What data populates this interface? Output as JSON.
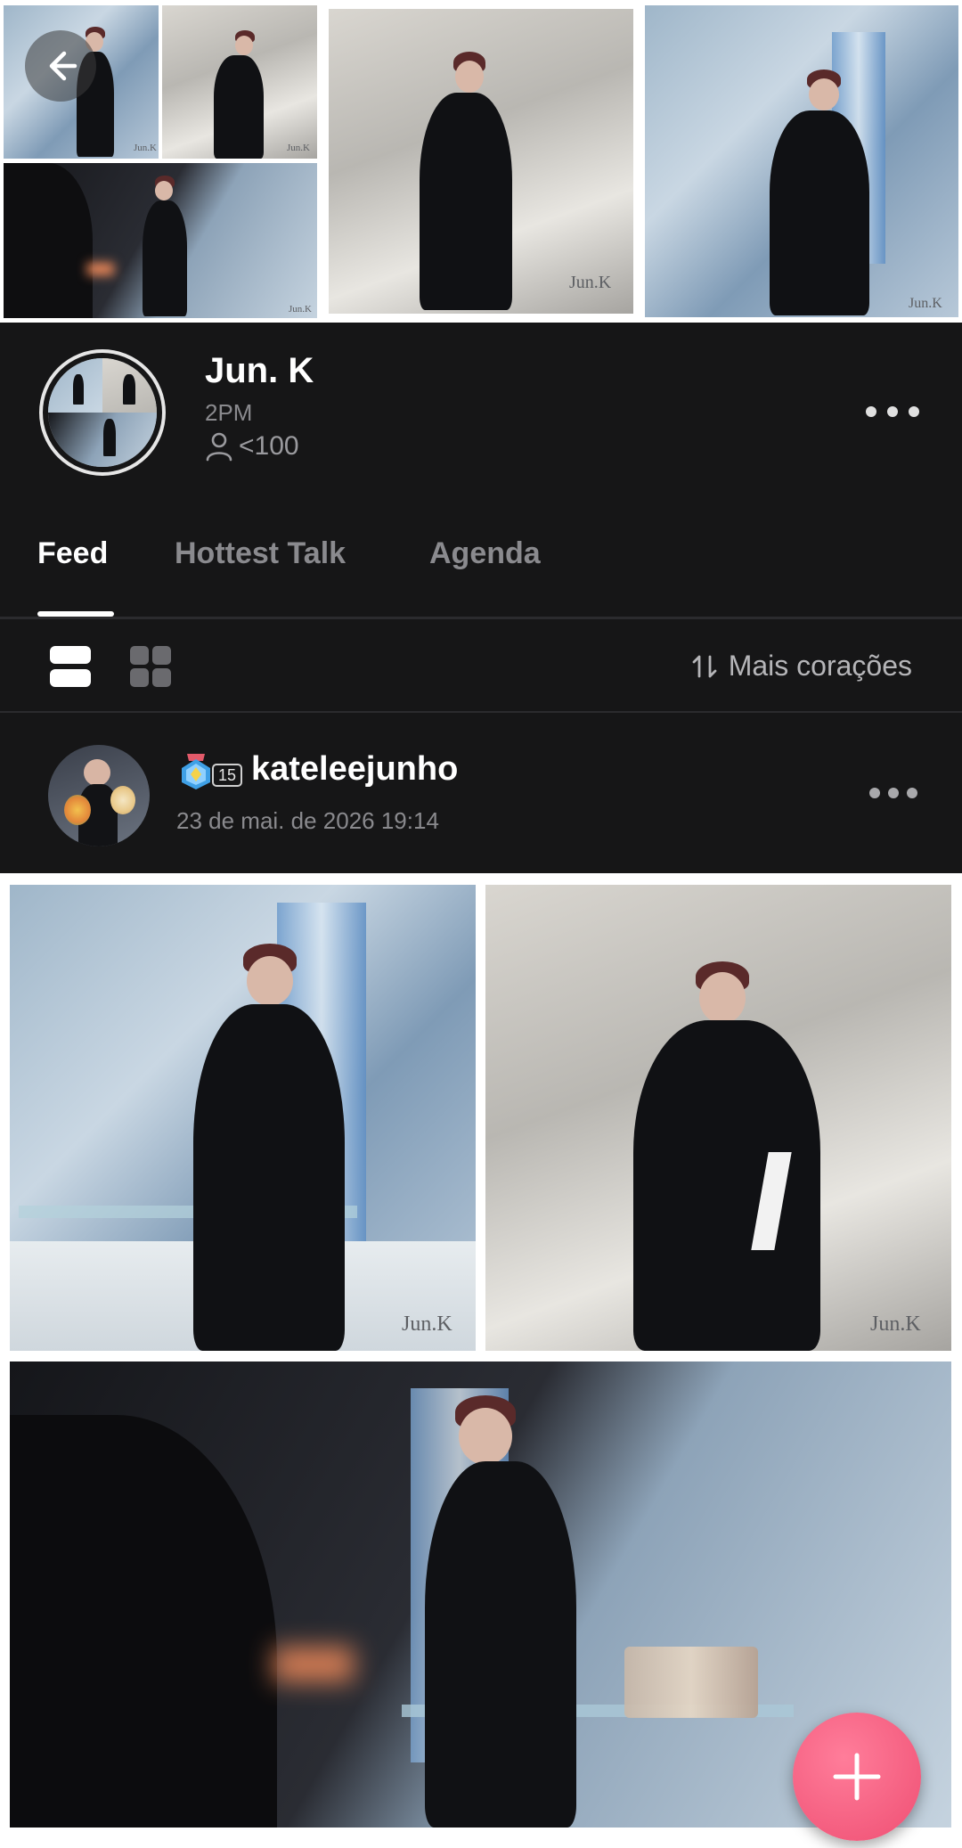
{
  "community": {
    "name": "Jun. K",
    "group": "2PM",
    "members": "<100"
  },
  "tabs": [
    {
      "label": "Feed",
      "active": true
    },
    {
      "label": "Hottest Talk",
      "active": false
    },
    {
      "label": "Agenda",
      "active": false
    }
  ],
  "toolbar": {
    "sort_label": "Mais corações",
    "view_modes": [
      "list-view-icon",
      "grid-view-icon"
    ]
  },
  "post": {
    "username": "kateleejunho",
    "level": "15",
    "date": "23 de mai. de 2026 19:14"
  },
  "watermark": "Jun.K",
  "icons": {
    "back": "arrow-left-icon",
    "more": "more-horizontal-icon",
    "member": "person-icon",
    "sort": "sort-arrows-icon",
    "add": "plus-icon"
  },
  "colors": {
    "background": "#161617",
    "fab": "#ef4f73",
    "muted_text": "#8a8a8e"
  }
}
